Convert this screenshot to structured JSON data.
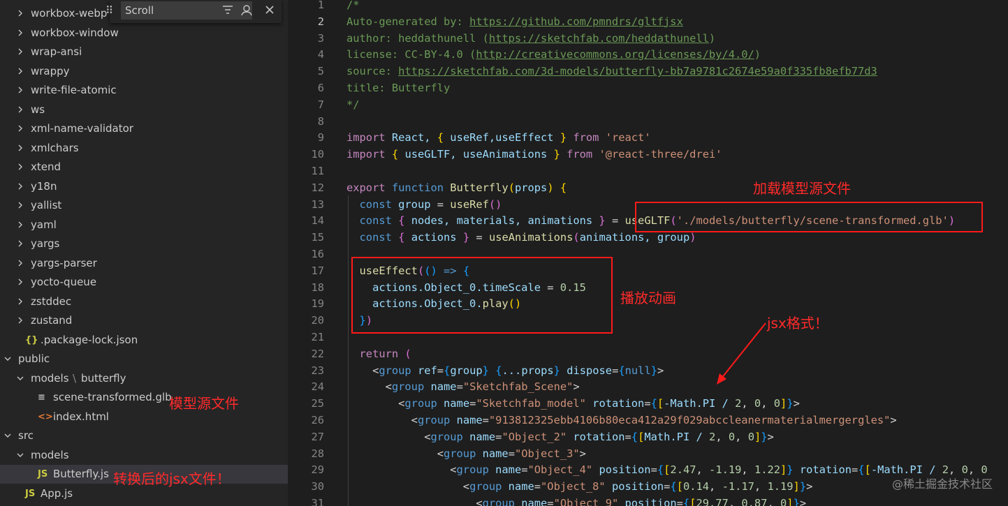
{
  "explorer": {
    "items": [
      {
        "label": "workbox-webp",
        "kind": "folder",
        "expanded": false
      },
      {
        "label": "workbox-window",
        "kind": "folder",
        "expanded": false
      },
      {
        "label": "wrap-ansi",
        "kind": "folder",
        "expanded": false
      },
      {
        "label": "wrappy",
        "kind": "folder",
        "expanded": false
      },
      {
        "label": "write-file-atomic",
        "kind": "folder",
        "expanded": false
      },
      {
        "label": "ws",
        "kind": "folder",
        "expanded": false
      },
      {
        "label": "xml-name-validator",
        "kind": "folder",
        "expanded": false
      },
      {
        "label": "xmlchars",
        "kind": "folder",
        "expanded": false
      },
      {
        "label": "xtend",
        "kind": "folder",
        "expanded": false
      },
      {
        "label": "y18n",
        "kind": "folder",
        "expanded": false
      },
      {
        "label": "yallist",
        "kind": "folder",
        "expanded": false
      },
      {
        "label": "yaml",
        "kind": "folder",
        "expanded": false
      },
      {
        "label": "yargs",
        "kind": "folder",
        "expanded": false
      },
      {
        "label": "yargs-parser",
        "kind": "folder",
        "expanded": false
      },
      {
        "label": "yocto-queue",
        "kind": "folder",
        "expanded": false
      },
      {
        "label": "zstddec",
        "kind": "folder",
        "expanded": false
      },
      {
        "label": "zustand",
        "kind": "folder",
        "expanded": false
      },
      {
        "label": ".package-lock.json",
        "kind": "json",
        "icon": "{}"
      },
      {
        "label": "public",
        "kind": "folder",
        "expanded": true
      },
      {
        "label": "models",
        "sep": "\\",
        "label2": "butterfly",
        "kind": "folder",
        "expanded": true
      },
      {
        "label": "scene-transformed.glb",
        "kind": "glb",
        "icon": "≡"
      },
      {
        "label": "index.html",
        "kind": "html",
        "icon": "<>"
      },
      {
        "label": "src",
        "kind": "folder",
        "expanded": true
      },
      {
        "label": "models",
        "kind": "folder",
        "expanded": true
      },
      {
        "label": "Butterfly.js",
        "kind": "js",
        "icon": "JS",
        "selected": true
      },
      {
        "label": "App.js",
        "kind": "js",
        "icon": "JS"
      }
    ]
  },
  "find_widget": {
    "value": "Scroll"
  },
  "editor": {
    "active_line": 2,
    "lines": [
      {
        "n": "1",
        "tokens": [
          [
            "/*",
            "com"
          ]
        ]
      },
      {
        "n": "2",
        "tokens": [
          [
            "Auto-generated by: ",
            "com"
          ],
          [
            "https://github.com/pmndrs/gltfjsx",
            "link"
          ]
        ]
      },
      {
        "n": "3",
        "tokens": [
          [
            "author: heddathunell (",
            "com"
          ],
          [
            "https://sketchfab.com/heddathunell",
            "link"
          ],
          [
            ")",
            "com"
          ]
        ]
      },
      {
        "n": "4",
        "tokens": [
          [
            "license: CC-BY-4.0 (",
            "com"
          ],
          [
            "http://creativecommons.org/licenses/by/4.0/",
            "link"
          ],
          [
            ")",
            "com"
          ]
        ]
      },
      {
        "n": "5",
        "tokens": [
          [
            "source: ",
            "com"
          ],
          [
            "https://sketchfab.com/3d-models/butterfly-bb7a9781c2674e59a0f335fb8efb77d3",
            "link"
          ]
        ]
      },
      {
        "n": "6",
        "tokens": [
          [
            "title: Butterfly",
            "com"
          ]
        ]
      },
      {
        "n": "7",
        "tokens": [
          [
            "*/",
            "com"
          ]
        ]
      },
      {
        "n": "8",
        "tokens": []
      },
      {
        "n": "9",
        "tokens": [
          [
            "import",
            "kw2"
          ],
          [
            " React, ",
            "id"
          ],
          [
            "{",
            "br1"
          ],
          [
            " useRef,useEffect ",
            "id"
          ],
          [
            "}",
            "br1"
          ],
          [
            " from ",
            "kw2"
          ],
          [
            "'react'",
            "str"
          ]
        ]
      },
      {
        "n": "10",
        "tokens": [
          [
            "import",
            "kw2"
          ],
          [
            " ",
            "pl"
          ],
          [
            "{",
            "br1"
          ],
          [
            " useGLTF, useAnimations ",
            "id"
          ],
          [
            "}",
            "br1"
          ],
          [
            " from ",
            "kw2"
          ],
          [
            "'@react-three/drei'",
            "str"
          ]
        ]
      },
      {
        "n": "11",
        "tokens": []
      },
      {
        "n": "12",
        "tokens": [
          [
            "export",
            "kw2"
          ],
          [
            " function ",
            "kw"
          ],
          [
            "Butterfly",
            "fn"
          ],
          [
            "(",
            "br1"
          ],
          [
            "props",
            "id"
          ],
          [
            ")",
            "br1"
          ],
          [
            " ",
            "pl"
          ],
          [
            "{",
            "br1"
          ]
        ]
      },
      {
        "n": "13",
        "tokens": [
          [
            "  const",
            "kw"
          ],
          [
            " group ",
            "id"
          ],
          [
            "= ",
            "pl"
          ],
          [
            "useRef",
            "fn"
          ],
          [
            "()",
            "br2"
          ]
        ]
      },
      {
        "n": "14",
        "tokens": [
          [
            "  const",
            "kw"
          ],
          [
            " ",
            "pl"
          ],
          [
            "{",
            "br2"
          ],
          [
            " nodes, materials, animations ",
            "id"
          ],
          [
            "}",
            "br2"
          ],
          [
            " = ",
            "pl"
          ],
          [
            "useGLTF",
            "fn"
          ],
          [
            "(",
            "br2"
          ],
          [
            "'./models/butterfly/scene-transformed.glb'",
            "str"
          ],
          [
            ")",
            "br2"
          ]
        ]
      },
      {
        "n": "15",
        "tokens": [
          [
            "  const",
            "kw"
          ],
          [
            " ",
            "pl"
          ],
          [
            "{",
            "br2"
          ],
          [
            " actions ",
            "id"
          ],
          [
            "}",
            "br2"
          ],
          [
            " = ",
            "pl"
          ],
          [
            "useAnimations",
            "fn"
          ],
          [
            "(",
            "br2"
          ],
          [
            "animations, group",
            "id"
          ],
          [
            ")",
            "br2"
          ]
        ]
      },
      {
        "n": "16",
        "tokens": []
      },
      {
        "n": "17",
        "tokens": [
          [
            "  useEffect",
            "fn"
          ],
          [
            "(",
            "br2"
          ],
          [
            "()",
            "br3"
          ],
          [
            " => ",
            "kw"
          ],
          [
            "{",
            "br3"
          ]
        ]
      },
      {
        "n": "18",
        "tokens": [
          [
            "    actions.Object_0.timeScale ",
            "id"
          ],
          [
            "= ",
            "pl"
          ],
          [
            "0.15",
            "num"
          ]
        ]
      },
      {
        "n": "19",
        "tokens": [
          [
            "    actions.Object_0.",
            "id"
          ],
          [
            "play",
            "fn"
          ],
          [
            "()",
            "br1"
          ]
        ]
      },
      {
        "n": "20",
        "tokens": [
          [
            "  ",
            "pl"
          ],
          [
            "}",
            "br3"
          ],
          [
            ")",
            "br2"
          ]
        ]
      },
      {
        "n": "21",
        "tokens": []
      },
      {
        "n": "22",
        "tokens": [
          [
            "  return",
            "kw2"
          ],
          [
            " ",
            "pl"
          ],
          [
            "(",
            "br2"
          ]
        ]
      },
      {
        "n": "23",
        "tokens": [
          [
            "    <",
            "pl"
          ],
          [
            "group",
            "tag"
          ],
          [
            " ref",
            "id"
          ],
          [
            "=",
            "pl"
          ],
          [
            "{",
            "br3"
          ],
          [
            "group",
            "id"
          ],
          [
            "}",
            "br3"
          ],
          [
            " ",
            "pl"
          ],
          [
            "{",
            "br3"
          ],
          [
            "...props",
            "id"
          ],
          [
            "}",
            "br3"
          ],
          [
            " dispose",
            "id"
          ],
          [
            "=",
            "pl"
          ],
          [
            "{",
            "br3"
          ],
          [
            "null",
            "kw"
          ],
          [
            "}",
            "br3"
          ],
          [
            ">",
            "pl"
          ]
        ]
      },
      {
        "n": "24",
        "tokens": [
          [
            "      <",
            "pl"
          ],
          [
            "group",
            "tag"
          ],
          [
            " name",
            "id"
          ],
          [
            "=",
            "pl"
          ],
          [
            "\"Sketchfab_Scene\"",
            "str"
          ],
          [
            ">",
            "pl"
          ]
        ]
      },
      {
        "n": "25",
        "tokens": [
          [
            "        <",
            "pl"
          ],
          [
            "group",
            "tag"
          ],
          [
            " name",
            "id"
          ],
          [
            "=",
            "pl"
          ],
          [
            "\"Sketchfab_model\"",
            "str"
          ],
          [
            " rotation",
            "id"
          ],
          [
            "=",
            "pl"
          ],
          [
            "{",
            "br3"
          ],
          [
            "[",
            "br1"
          ],
          [
            "-Math.PI / ",
            "id"
          ],
          [
            "2",
            "num"
          ],
          [
            ", ",
            "pl"
          ],
          [
            "0",
            "num"
          ],
          [
            ", ",
            "pl"
          ],
          [
            "0",
            "num"
          ],
          [
            "]",
            "br1"
          ],
          [
            "}",
            "br3"
          ],
          [
            ">",
            "pl"
          ]
        ]
      },
      {
        "n": "26",
        "tokens": [
          [
            "          <",
            "pl"
          ],
          [
            "group",
            "tag"
          ],
          [
            " name",
            "id"
          ],
          [
            "=",
            "pl"
          ],
          [
            "\"913812325ebb4106b80eca412a29f029abccleanermaterialmergergles\"",
            "str"
          ],
          [
            ">",
            "pl"
          ]
        ]
      },
      {
        "n": "27",
        "tokens": [
          [
            "            <",
            "pl"
          ],
          [
            "group",
            "tag"
          ],
          [
            " name",
            "id"
          ],
          [
            "=",
            "pl"
          ],
          [
            "\"Object_2\"",
            "str"
          ],
          [
            " rotation",
            "id"
          ],
          [
            "=",
            "pl"
          ],
          [
            "{",
            "br3"
          ],
          [
            "[",
            "br1"
          ],
          [
            "Math.PI / ",
            "id"
          ],
          [
            "2",
            "num"
          ],
          [
            ", ",
            "pl"
          ],
          [
            "0",
            "num"
          ],
          [
            ", ",
            "pl"
          ],
          [
            "0",
            "num"
          ],
          [
            "]",
            "br1"
          ],
          [
            "}",
            "br3"
          ],
          [
            ">",
            "pl"
          ]
        ]
      },
      {
        "n": "28",
        "tokens": [
          [
            "              <",
            "pl"
          ],
          [
            "group",
            "tag"
          ],
          [
            " name",
            "id"
          ],
          [
            "=",
            "pl"
          ],
          [
            "\"Object_3\"",
            "str"
          ],
          [
            ">",
            "pl"
          ]
        ]
      },
      {
        "n": "29",
        "tokens": [
          [
            "                <",
            "pl"
          ],
          [
            "group",
            "tag"
          ],
          [
            " name",
            "id"
          ],
          [
            "=",
            "pl"
          ],
          [
            "\"Object_4\"",
            "str"
          ],
          [
            " position",
            "id"
          ],
          [
            "=",
            "pl"
          ],
          [
            "{",
            "br3"
          ],
          [
            "[",
            "br1"
          ],
          [
            "2.47",
            "num"
          ],
          [
            ", ",
            "pl"
          ],
          [
            "-1.19",
            "num"
          ],
          [
            ", ",
            "pl"
          ],
          [
            "1.22",
            "num"
          ],
          [
            "]",
            "br1"
          ],
          [
            "}",
            "br3"
          ],
          [
            " rotation",
            "id"
          ],
          [
            "=",
            "pl"
          ],
          [
            "{",
            "br3"
          ],
          [
            "[",
            "br1"
          ],
          [
            "-Math.PI / ",
            "id"
          ],
          [
            "2",
            "num"
          ],
          [
            ", ",
            "pl"
          ],
          [
            "0",
            "num"
          ],
          [
            ", ",
            "pl"
          ],
          [
            "0",
            "num"
          ]
        ]
      },
      {
        "n": "30",
        "tokens": [
          [
            "                  <",
            "pl"
          ],
          [
            "group",
            "tag"
          ],
          [
            " name",
            "id"
          ],
          [
            "=",
            "pl"
          ],
          [
            "\"Object_8\"",
            "str"
          ],
          [
            " position",
            "id"
          ],
          [
            "=",
            "pl"
          ],
          [
            "{",
            "br3"
          ],
          [
            "[",
            "br1"
          ],
          [
            "0.14",
            "num"
          ],
          [
            ", ",
            "pl"
          ],
          [
            "-1.17",
            "num"
          ],
          [
            ", ",
            "pl"
          ],
          [
            "1.19",
            "num"
          ],
          [
            "]",
            "br1"
          ],
          [
            "}",
            "br3"
          ],
          [
            ">",
            "pl"
          ]
        ]
      },
      {
        "n": "31",
        "tokens": [
          [
            "                    <",
            "pl"
          ],
          [
            "group",
            "tag"
          ],
          [
            " name",
            "id"
          ],
          [
            "=",
            "pl"
          ],
          [
            "\"Object_9\"",
            "str"
          ],
          [
            " position",
            "id"
          ],
          [
            "=",
            "pl"
          ],
          [
            "{",
            "br3"
          ],
          [
            "[",
            "br1"
          ],
          [
            "29.77",
            "num"
          ],
          [
            ", ",
            "pl"
          ],
          [
            "0.87",
            "num"
          ],
          [
            ", ",
            "pl"
          ],
          [
            "0",
            "num"
          ],
          [
            "]",
            "br1"
          ],
          [
            "}",
            "br3"
          ],
          [
            ">",
            "pl"
          ]
        ]
      }
    ]
  },
  "annotations": {
    "load_model": "加载模型源文件",
    "play_anim": "播放动画",
    "jsx_format": "jsx格式！",
    "model_source": "模型源文件",
    "converted_jsx": "转换后的jsx文件！"
  },
  "watermark": "@稀土掘金技术社区",
  "colors": {
    "accent_red": "#ff1a1a",
    "background": "#1e1e1e",
    "sidebar": "#252526"
  }
}
